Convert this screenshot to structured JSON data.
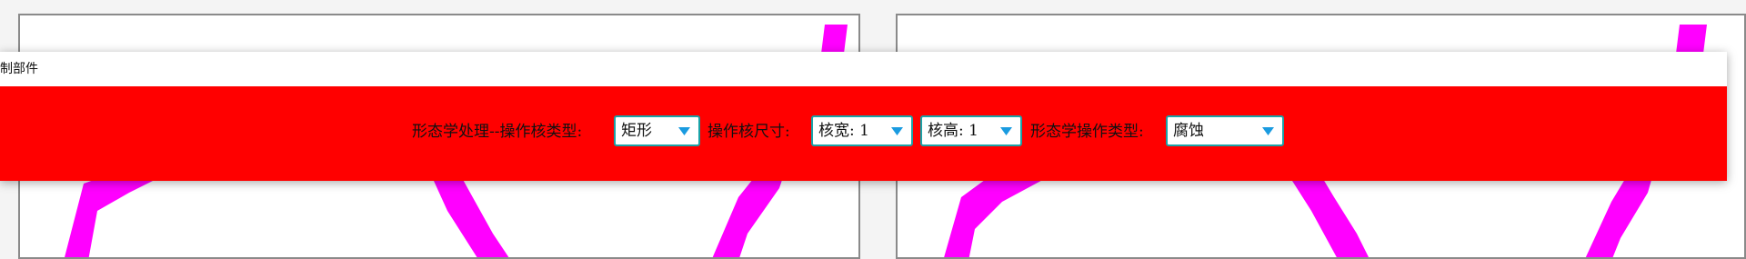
{
  "widget": {
    "title": "制部件"
  },
  "toolbar": {
    "kernel_type_label": "形态学处理--操作核类型:",
    "kernel_type_value": "矩形",
    "kernel_size_label": "操作核尺寸:",
    "kernel_width_value": "核宽: 1",
    "kernel_height_value": "核高: 1",
    "op_type_label": "形态学操作类型:",
    "op_type_value": "腐蚀"
  },
  "colors": {
    "toolbar_bg": "#ff0000",
    "stroke": "#ff00ff",
    "combo_border": "#19a3a8",
    "dropdown_arrow": "#1a9be0"
  },
  "icons": {
    "dropdown": "chevron-down-icon"
  }
}
